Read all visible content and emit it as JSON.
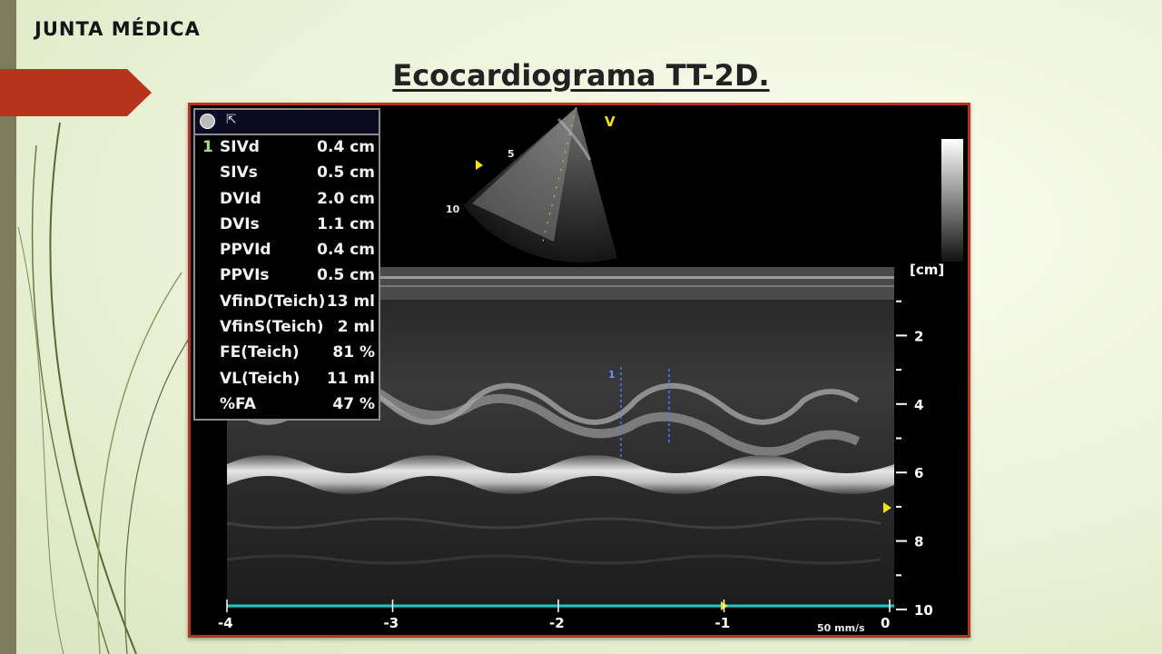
{
  "header": {
    "label": "JUNTA MÉDICA"
  },
  "slide": {
    "title": "Ecocardiograma TT-2D."
  },
  "colors": {
    "accent_red": "#b5341b",
    "sidebar": "#7c7b5a",
    "baseline_teal": "#23c5c5",
    "marker_yellow": "#f2e21c"
  },
  "sector": {
    "view_label": "V",
    "depth_labels": [
      "5",
      "10"
    ]
  },
  "measurements": {
    "active_index": "1",
    "items": [
      {
        "name": "SIVd",
        "value": "0.4 cm"
      },
      {
        "name": "SIVs",
        "value": "0.5 cm"
      },
      {
        "name": "DVId",
        "value": "2.0 cm"
      },
      {
        "name": "DVIs",
        "value": "1.1 cm"
      },
      {
        "name": "PPVId",
        "value": "0.4 cm"
      },
      {
        "name": "PPVIs",
        "value": "0.5 cm"
      },
      {
        "name": "VfinD(Teich)",
        "value": "13 ml"
      },
      {
        "name": "VfinS(Teich)",
        "value": "2 ml"
      },
      {
        "name": "FE(Teich)",
        "value": "81 %"
      },
      {
        "name": "VL(Teich)",
        "value": "11 ml"
      },
      {
        "name": "%FA",
        "value": "47 %"
      }
    ]
  },
  "depth_axis": {
    "unit": "[cm]",
    "ticks": [
      "2",
      "4",
      "6",
      "8",
      "10"
    ]
  },
  "time_axis": {
    "ticks": [
      "-4",
      "-3",
      "-2",
      "-1",
      "0"
    ],
    "sweep": "50 mm/s"
  },
  "caliper": {
    "label": "1"
  }
}
